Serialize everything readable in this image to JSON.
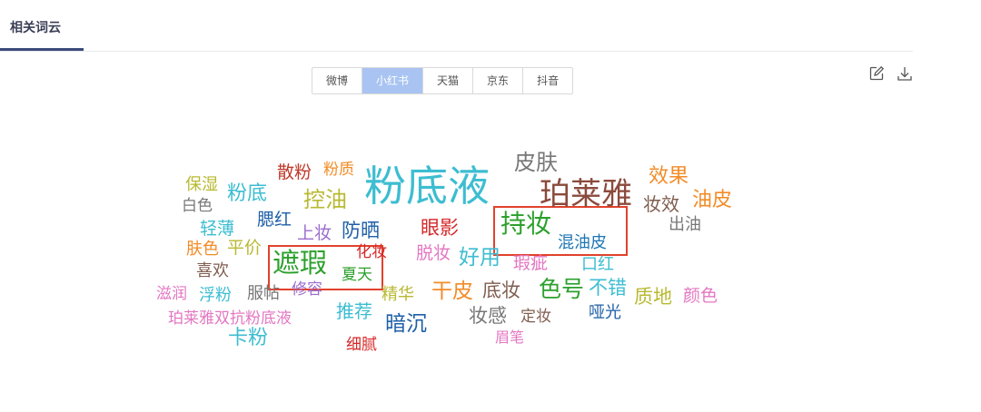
{
  "header": {
    "title": "相关词云"
  },
  "platforms": {
    "active": "小红书",
    "tabs": [
      "微博",
      "小红书",
      "天猫",
      "京东",
      "抖音"
    ]
  },
  "toolbar": {
    "edit_icon": "edit-icon",
    "download_icon": "download-icon"
  },
  "word_cloud": {
    "words": [
      {
        "text": "粉底液",
        "color": "#3dbdd1"
      },
      {
        "text": "珀莱雅",
        "color": "#8b4a3c"
      },
      {
        "text": "皮肤",
        "color": "#777777"
      },
      {
        "text": "效果",
        "color": "#f28c28"
      },
      {
        "text": "油皮",
        "color": "#f28c28"
      },
      {
        "text": "妆效",
        "color": "#7f5d4f"
      },
      {
        "text": "出油",
        "color": "#777777"
      },
      {
        "text": "散粉",
        "color": "#c0392b"
      },
      {
        "text": "粉质",
        "color": "#f28c28"
      },
      {
        "text": "保湿",
        "color": "#b9b933"
      },
      {
        "text": "粉底",
        "color": "#3dbdd1"
      },
      {
        "text": "控油",
        "color": "#b9b933"
      },
      {
        "text": "白色",
        "color": "#777777"
      },
      {
        "text": "轻薄",
        "color": "#3dbdd1"
      },
      {
        "text": "腮红",
        "color": "#1f5fa8"
      },
      {
        "text": "上妆",
        "color": "#9b6dcf"
      },
      {
        "text": "防晒",
        "color": "#1f5fa8"
      },
      {
        "text": "眼影",
        "color": "#d62728"
      },
      {
        "text": "持妆",
        "color": "#2ca02c"
      },
      {
        "text": "混油皮",
        "color": "#1f77b4"
      },
      {
        "text": "肤色",
        "color": "#f28c28"
      },
      {
        "text": "平价",
        "color": "#b9b933"
      },
      {
        "text": "遮瑕",
        "color": "#2ca02c"
      },
      {
        "text": "化妆",
        "color": "#d62728"
      },
      {
        "text": "夏天",
        "color": "#2ca02c"
      },
      {
        "text": "脱妆",
        "color": "#e377c2"
      },
      {
        "text": "好用",
        "color": "#3dbdd1"
      },
      {
        "text": "瑕疵",
        "color": "#e377c2"
      },
      {
        "text": "口红",
        "color": "#3dbdd1"
      },
      {
        "text": "喜欢",
        "color": "#7f5d4f"
      },
      {
        "text": "滋润",
        "color": "#e377c2"
      },
      {
        "text": "浮粉",
        "color": "#3dbdd1"
      },
      {
        "text": "服帖",
        "color": "#777777"
      },
      {
        "text": "修容",
        "color": "#9b6dcf"
      },
      {
        "text": "精华",
        "color": "#b9b933"
      },
      {
        "text": "干皮",
        "color": "#f28c28"
      },
      {
        "text": "底妆",
        "color": "#7f5d4f"
      },
      {
        "text": "色号",
        "color": "#2ca02c"
      },
      {
        "text": "不错",
        "color": "#3dbdd1"
      },
      {
        "text": "质地",
        "color": "#b9b933"
      },
      {
        "text": "颜色",
        "color": "#e377c2"
      },
      {
        "text": "珀莱雅双抗粉底液",
        "color": "#e377c2"
      },
      {
        "text": "推荐",
        "color": "#3dbdd1"
      },
      {
        "text": "妆感",
        "color": "#777777"
      },
      {
        "text": "定妆",
        "color": "#7f5d4f"
      },
      {
        "text": "哑光",
        "color": "#1f5fa8"
      },
      {
        "text": "卡粉",
        "color": "#3dbdd1"
      },
      {
        "text": "暗沉",
        "color": "#1f5fa8"
      },
      {
        "text": "细腻",
        "color": "#d62728"
      },
      {
        "text": "眉笔",
        "color": "#e377c2"
      }
    ]
  }
}
